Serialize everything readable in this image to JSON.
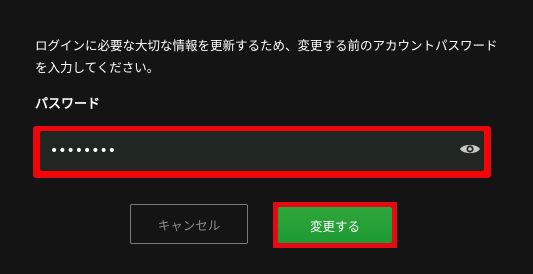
{
  "form": {
    "description": "ログインに必要な大切な情報を更新するため、変更する前のアカウントパスワードを入力してください。",
    "password_label": "パスワード",
    "password_value": "••••••••",
    "password_toggle_icon": "eye-icon",
    "cancel_label": "キャンセル",
    "submit_label": "変更する"
  },
  "colors": {
    "background": "#141414",
    "input_background": "#202621",
    "highlight_outline": "#e50914",
    "submit_green": "#23a136",
    "cancel_border": "#7a7a7a"
  }
}
